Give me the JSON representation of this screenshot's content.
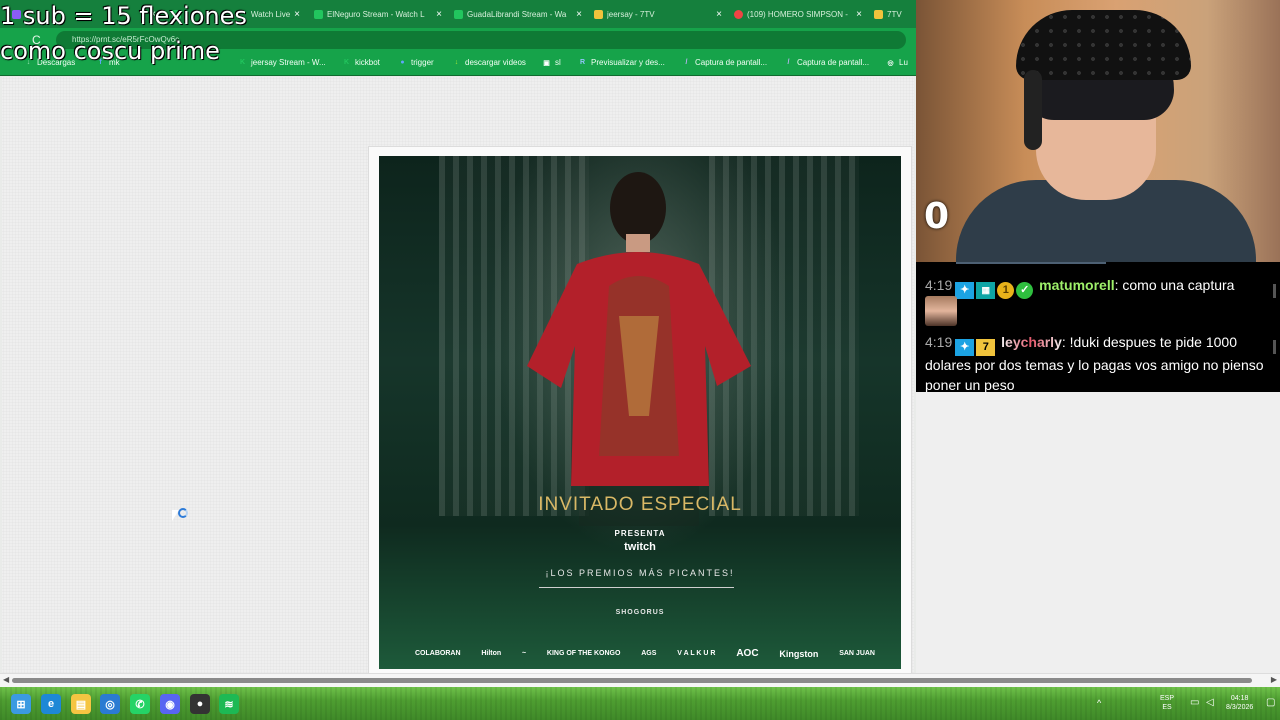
{
  "browser": {
    "tabs": [
      {
        "title": "",
        "close": "×",
        "favicon": "twitch",
        "color": "#8b5cf6"
      },
      {
        "title": "Watch Live",
        "close": "×",
        "favicon": "kick",
        "color": "#22c55e"
      },
      {
        "title": "ElNeguro Stream - Watch L",
        "close": "×",
        "favicon": "kick",
        "color": "#22c55e"
      },
      {
        "title": "GuadaLibrandi Stream - Wa",
        "close": "×",
        "favicon": "kick",
        "color": "#22c55e"
      },
      {
        "title": "jeersay - 7TV",
        "close": "×",
        "favicon": "7tv",
        "color": "#f0c33c"
      },
      {
        "title": "(109) HOMERO SIMPSON -",
        "close": "×",
        "favicon": "youtube",
        "color": "#ef4444"
      },
      {
        "title": "7TV",
        "close": "",
        "favicon": "7tv",
        "color": "#f0c33c"
      }
    ],
    "url": "https://prnt.sc/eR5rFcOwQv6c",
    "reload_glyph": "C",
    "bookmarks": [
      {
        "label": "Descargas",
        "icon": "download-icon",
        "color": "#9ae6b4"
      },
      {
        "label": "mk",
        "icon": "facebook-icon",
        "color": "#60a5fa"
      },
      {
        "label": "jeersay Stream - W...",
        "icon": "kick-icon",
        "color": "#22c55e"
      },
      {
        "label": "kickbot",
        "icon": "kick-icon",
        "color": "#22c55e"
      },
      {
        "label": "trigger",
        "icon": "drop-icon",
        "color": "#60a5fa"
      },
      {
        "label": "descargar videos",
        "icon": "download-icon",
        "color": "#a3e635"
      },
      {
        "label": "sl",
        "icon": "stream-icon",
        "color": "#ffffff"
      },
      {
        "label": "Previsualizar y des...",
        "icon": "rp-icon",
        "color": "#93c5fd"
      },
      {
        "label": "Captura de pantall...",
        "icon": "feather-icon",
        "color": "#c4b5fd"
      },
      {
        "label": "Captura de pantall...",
        "icon": "feather-icon",
        "color": "#c4b5fd"
      },
      {
        "label": "Lu",
        "icon": "globe-icon",
        "color": "#ffffff"
      }
    ]
  },
  "overlay": {
    "line1": "1 sub = 15 flexiones",
    "line2": "como coscu prime"
  },
  "poster": {
    "title": "INVITADO ESPECIAL",
    "presenta": "PRESENTA",
    "twitch": "twitch",
    "tagline": "¡LOS PREMIOS MÁS PICANTES!",
    "shogo": "SHOGORUS",
    "sponsors": [
      "COLABORAN",
      "Hilton",
      "~",
      "KING OF THE KONGO",
      "AGS",
      "V A L K U R",
      "AOC",
      "Kingston",
      "SAN JUAN"
    ]
  },
  "webcam": {
    "sub_count": "0"
  },
  "chat": {
    "messages": [
      {
        "time": "4:19",
        "badges": [
          "mod",
          "sub",
          "gold",
          "verified"
        ],
        "badge_text": [
          "",
          "",
          "1",
          "✓"
        ],
        "user": "matumorell",
        "text": "como una captura"
      },
      {
        "time": "4:19",
        "badges": [
          "mod",
          "7tv"
        ],
        "badge_text": [
          "",
          "7"
        ],
        "user": "leycharly",
        "text": "!duki despues te pide 1000 dolares por dos temas y lo pagas vos amigo no pienso poner un peso"
      }
    ]
  },
  "taskbar": {
    "apps": [
      {
        "name": "start",
        "glyph": "⊞",
        "color": "#3b9ae1"
      },
      {
        "name": "edge",
        "glyph": "e",
        "color": "#1e88d6"
      },
      {
        "name": "explorer",
        "glyph": "▤",
        "color": "#f5c542"
      },
      {
        "name": "chrome",
        "glyph": "◎",
        "color": "#2b7bd2"
      },
      {
        "name": "whatsapp",
        "glyph": "✆",
        "color": "#25d366"
      },
      {
        "name": "discord",
        "glyph": "◉",
        "color": "#5865f2"
      },
      {
        "name": "obs",
        "glyph": "●",
        "color": "#333333"
      },
      {
        "name": "spotify",
        "glyph": "≋",
        "color": "#1db954"
      }
    ],
    "lang_top": "ESP",
    "lang_bottom": "ES",
    "time": "04:18",
    "date": "8/3/2026"
  }
}
